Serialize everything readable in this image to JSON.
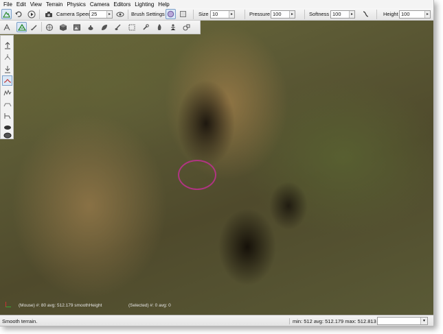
{
  "menu": [
    "File",
    "Edit",
    "View",
    "Terrain",
    "Physics",
    "Camera",
    "Editors",
    "Lighting",
    "Help"
  ],
  "toolbar": {
    "camera_speed_label": "Camera Speed",
    "camera_speed_value": "25",
    "brush_settings_label": "Brush Settings",
    "size_label": "Size",
    "size_value": "10",
    "pressure_label": "Pressure",
    "pressure_value": "100",
    "softness_label": "Softness",
    "softness_value": "100",
    "height_label": "Height",
    "height_value": "100"
  },
  "viewport": {
    "mouse_readout": "(Mouse) #: 80  avg: 512.179 smoothHeight",
    "selected_readout": "(Selected) #: 0  avg: 0"
  },
  "status": {
    "message": "Smooth terrain.",
    "stats": "min: 512  avg: 512.179  max: 512.813",
    "dropdown_value": ""
  },
  "colors": {
    "brush_circle": "#c03090",
    "active_tool": "#dbe8f6"
  }
}
